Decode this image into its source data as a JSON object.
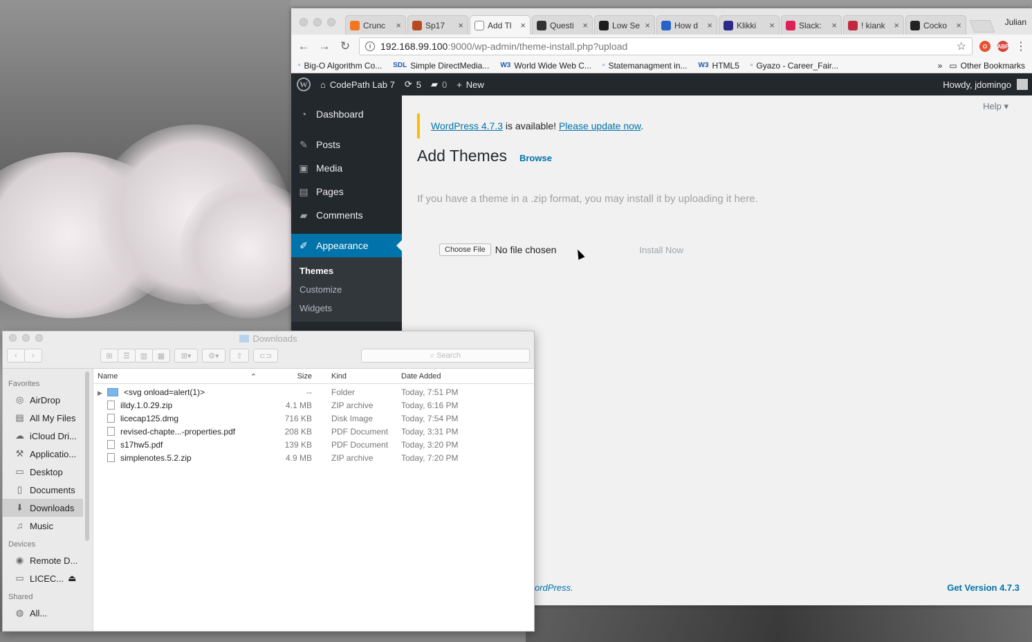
{
  "browser": {
    "profile": "Julian",
    "tabs": [
      {
        "label": "Crunc",
        "icon": "crunchyroll-icon",
        "color": "#f47521"
      },
      {
        "label": "Sp17",
        "icon": "sp17-icon",
        "color": "#b84a1f"
      },
      {
        "label": "Add Tl",
        "icon": "page-icon",
        "color": "#ffffff"
      },
      {
        "label": "Questi",
        "icon": "c-icon",
        "color": "#333333"
      },
      {
        "label": "Low Se",
        "icon": "shield-icon",
        "color": "#1c1c1c"
      },
      {
        "label": "How d",
        "icon": "how-icon",
        "color": "#2563c9"
      },
      {
        "label": "Klikki",
        "icon": "klikki-icon",
        "color": "#2a2a8a"
      },
      {
        "label": "Slack:",
        "icon": "slack-icon",
        "color": "#e01e5a"
      },
      {
        "label": "! kiank",
        "icon": "kiank-icon",
        "color": "#c0283e"
      },
      {
        "label": "Cocko",
        "icon": "cockos-icon",
        "color": "#222222"
      }
    ],
    "url_host": "192.168.99.100",
    "url_path": ":9000/wp-admin/theme-install.php?upload",
    "bookmarks": [
      {
        "label": "Big-O Algorithm Co...",
        "icon": "page-icon"
      },
      {
        "label": "Simple DirectMedia...",
        "icon": "sdl-icon",
        "prefix": "SDL"
      },
      {
        "label": "World Wide Web C...",
        "icon": "w3-icon",
        "prefix": "W3"
      },
      {
        "label": "Statemanagment in...",
        "icon": "figure-icon"
      },
      {
        "label": "HTML5",
        "icon": "w3-icon",
        "prefix": "W3"
      },
      {
        "label": "Gyazo - Career_Fair...",
        "icon": "gyazo-icon"
      }
    ],
    "more_bookmarks": "»",
    "other_bookmarks": "Other Bookmarks"
  },
  "wp": {
    "adminbar": {
      "site": "CodePath Lab 7",
      "updates": "5",
      "comments": "0",
      "new": "New",
      "howdy": "Howdy, jdomingo"
    },
    "menu": {
      "dashboard": "Dashboard",
      "posts": "Posts",
      "media": "Media",
      "pages": "Pages",
      "comments": "Comments",
      "appearance": "Appearance",
      "submenu": [
        "Themes",
        "Customize",
        "Widgets"
      ]
    },
    "help": "Help",
    "notice": {
      "link1": "WordPress 4.7.3",
      "middle": " is available! ",
      "link2": "Please update now",
      "end": "."
    },
    "title": "Add Themes",
    "browse": "Browse",
    "upload_help": "If you have a theme in a .zip format, you may install it by uploading it here.",
    "choose_file": "Choose File",
    "no_file": "No file chosen",
    "install_now": "Install Now",
    "footer_left": "ordPress.",
    "footer_right": "Get Version 4.7.3"
  },
  "finder": {
    "title": "Downloads",
    "search_placeholder": "Search",
    "sidebar": {
      "favorites_label": "Favorites",
      "favorites": [
        {
          "label": "AirDrop",
          "icon": "airdrop-icon"
        },
        {
          "label": "All My Files",
          "icon": "all-files-icon"
        },
        {
          "label": "iCloud Dri...",
          "icon": "icloud-icon"
        },
        {
          "label": "Applicatio...",
          "icon": "applications-icon"
        },
        {
          "label": "Desktop",
          "icon": "desktop-icon"
        },
        {
          "label": "Documents",
          "icon": "documents-icon"
        },
        {
          "label": "Downloads",
          "icon": "downloads-icon"
        },
        {
          "label": "Music",
          "icon": "music-icon"
        }
      ],
      "devices_label": "Devices",
      "devices": [
        {
          "label": "Remote D...",
          "icon": "disc-icon"
        },
        {
          "label": "LICEC...",
          "icon": "drive-icon"
        }
      ],
      "shared_label": "Shared",
      "shared": [
        {
          "label": "All...",
          "icon": "network-icon"
        }
      ]
    },
    "columns": {
      "name": "Name",
      "size": "Size",
      "kind": "Kind",
      "date": "Date Added"
    },
    "files": [
      {
        "name": "<svg onload=alert(1)>",
        "size": "--",
        "kind": "Folder",
        "date": "Today, 7:51 PM"
      },
      {
        "name": "illdy.1.0.29.zip",
        "size": "4.1 MB",
        "kind": "ZIP archive",
        "date": "Today, 6:16 PM"
      },
      {
        "name": "licecap125.dmg",
        "size": "716 KB",
        "kind": "Disk Image",
        "date": "Today, 7:54 PM"
      },
      {
        "name": "revised-chapte...-properties.pdf",
        "size": "208 KB",
        "kind": "PDF Document",
        "date": "Today, 3:31 PM"
      },
      {
        "name": "s17hw5.pdf",
        "size": "139 KB",
        "kind": "PDF Document",
        "date": "Today, 3:20 PM"
      },
      {
        "name": "simplenotes.5.2.zip",
        "size": "4.9 MB",
        "kind": "ZIP archive",
        "date": "Today, 7:20 PM"
      }
    ]
  }
}
